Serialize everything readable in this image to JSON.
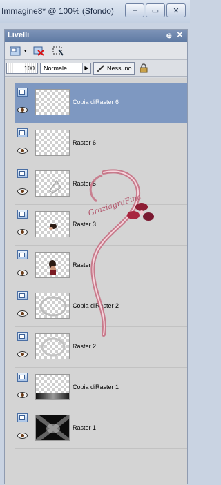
{
  "window": {
    "title": "Immagine8* @ 100% (Sfondo)",
    "buttons": {
      "minimize": "–",
      "restore": "▭",
      "close": "✕"
    }
  },
  "palette": {
    "title": "Livelli",
    "pin_label": "⊕",
    "close_label": "✕",
    "toolbar": {
      "new_layer_icon": "new-raster-layer-icon",
      "dropdown_glyph": "▾",
      "delete_icon": "delete-layer-icon",
      "mask_icon": "selection-icon"
    },
    "properties": {
      "opacity": "100",
      "blend_mode": "Normale",
      "blend_arrow": "▶",
      "lock_label": "Nessuno"
    }
  },
  "layers": [
    {
      "name": "Copia diRaster 6",
      "selected": true
    },
    {
      "name": "Raster 6",
      "selected": false
    },
    {
      "name": "Raster 5",
      "selected": false
    },
    {
      "name": "Raster 3",
      "selected": false
    },
    {
      "name": "Raster 4",
      "selected": false
    },
    {
      "name": "Copia diRaster 2",
      "selected": false
    },
    {
      "name": "Raster 2",
      "selected": false
    },
    {
      "name": "Copia diRaster 1",
      "selected": false
    },
    {
      "name": "Raster 1",
      "selected": false
    }
  ],
  "watermark": {
    "text": "GraziagraFina"
  },
  "colors": {
    "selected_row": "#7e98c1",
    "palette_title": "#5f7aa3",
    "watermark": "#c46a7e"
  }
}
